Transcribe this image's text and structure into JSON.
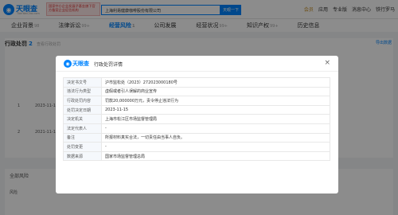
{
  "header": {
    "logo_text": "天眼查",
    "logo_sub": "TianYanCha.com",
    "banner_text": "国家中小企业发展子基金旗下官方备案企业征信机构",
    "search_value": "上海利易健康咖啡股份有限公司",
    "search_button": "天眼一下",
    "nav": [
      "会员",
      "应用",
      "专业版",
      "消息中心",
      "铁行罗马"
    ]
  },
  "tabs": [
    {
      "label": "企业背景",
      "count": "98"
    },
    {
      "label": "法律诉讼",
      "count": "99+"
    },
    {
      "label": "经营风险",
      "count": "1"
    },
    {
      "label": "公司发展",
      "count": ""
    },
    {
      "label": "经营状况",
      "count": "99+"
    },
    {
      "label": "知识产权",
      "count": "99+"
    },
    {
      "label": "历史信息",
      "count": ""
    }
  ],
  "section": {
    "title": "行政处罚",
    "count": "2",
    "hint": "查看行政处罚",
    "right": "导出数据"
  },
  "bg_rows": [
    {
      "idx": "1",
      "date": "2023-11-15"
    },
    {
      "idx": "2",
      "date": "2021-11-16"
    }
  ],
  "bg_lower": {
    "title": "全部风险",
    "label": "风险"
  },
  "modal": {
    "logo_text": "天眼查",
    "title": "行政处罚详情",
    "close_glyph": "×",
    "rows": [
      {
        "k": "决定书文号",
        "v": "沪市监松处（2023）272023000180号"
      },
      {
        "k": "违法行为类型",
        "v": "虚假或者引人误解的商业宣传"
      },
      {
        "k": "行政处罚内容",
        "v": "罚款20,000000万元，责令停止违法行为"
      },
      {
        "k": "处罚决定日期",
        "v": "2023-11-15"
      },
      {
        "k": "决定机关",
        "v": "上海市松江区市场监督管理局"
      },
      {
        "k": "法定代表人",
        "v": "-"
      },
      {
        "k": "备注",
        "v": "所报材料真实合法，一切责任由当事人自负。"
      },
      {
        "k": "处罚变更",
        "v": "-"
      },
      {
        "k": "数据来源",
        "v": "国家市场监督管理总局"
      }
    ]
  }
}
